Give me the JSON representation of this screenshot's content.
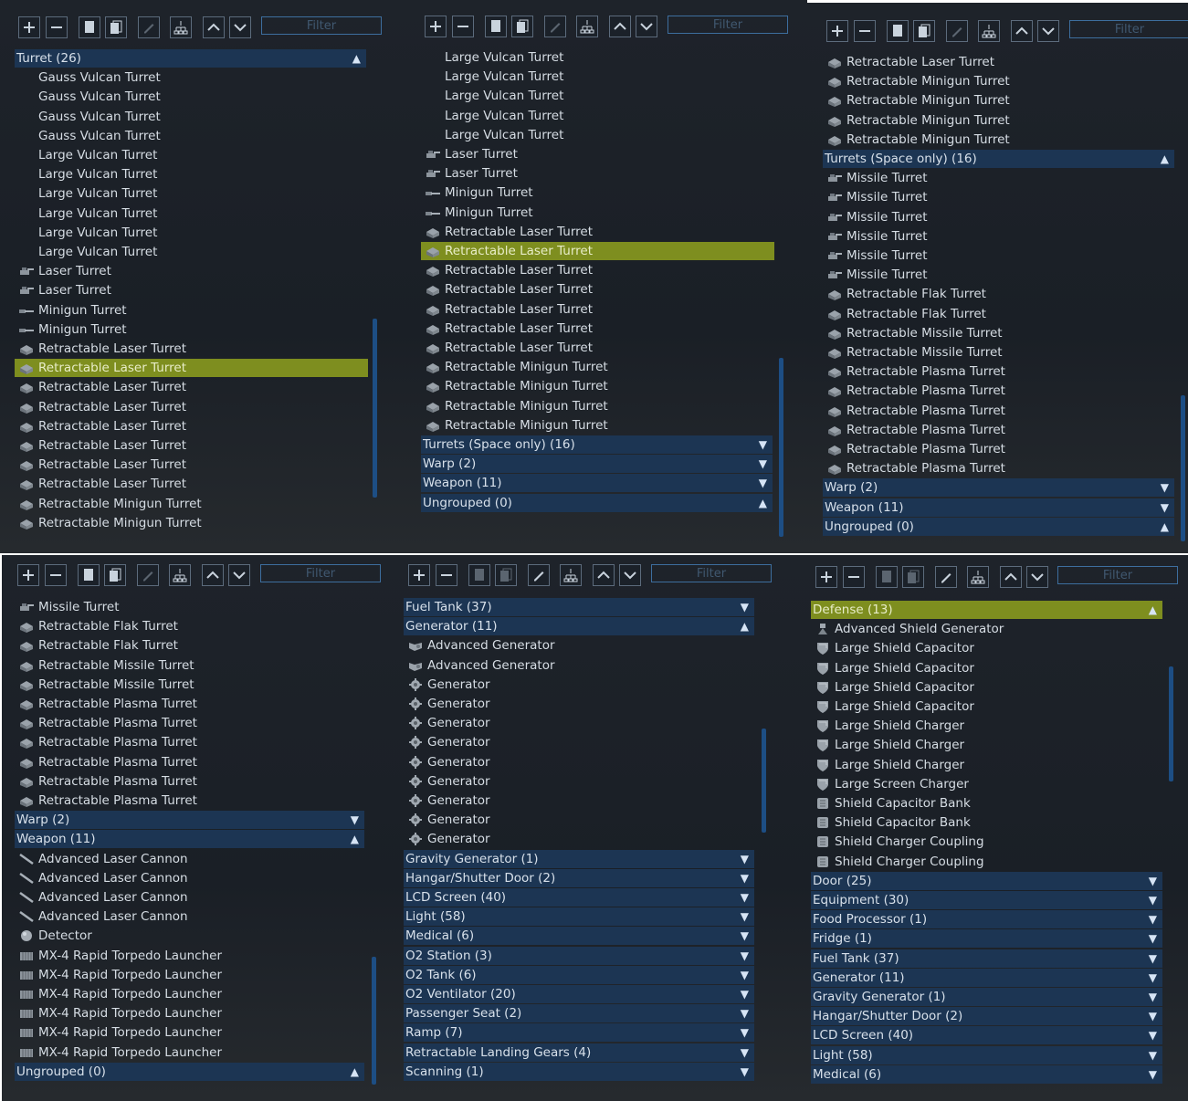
{
  "filter_placeholder": "Filter",
  "panels": [
    {
      "items": [
        {
          "type": "group",
          "label": "Turret (26)",
          "arrow": "▲"
        },
        {
          "type": "item",
          "label": "Gauss Vulcan Turret",
          "icon": "none"
        },
        {
          "type": "item",
          "label": "Gauss Vulcan Turret",
          "icon": "none"
        },
        {
          "type": "item",
          "label": "Gauss Vulcan Turret",
          "icon": "none"
        },
        {
          "type": "item",
          "label": "Gauss Vulcan Turret",
          "icon": "none"
        },
        {
          "type": "item",
          "label": "Large Vulcan Turret",
          "icon": "none"
        },
        {
          "type": "item",
          "label": "Large Vulcan Turret",
          "icon": "none"
        },
        {
          "type": "item",
          "label": "Large Vulcan Turret",
          "icon": "none"
        },
        {
          "type": "item",
          "label": "Large Vulcan Turret",
          "icon": "none"
        },
        {
          "type": "item",
          "label": "Large Vulcan Turret",
          "icon": "none"
        },
        {
          "type": "item",
          "label": "Large Vulcan Turret",
          "icon": "none"
        },
        {
          "type": "item",
          "label": "Laser Turret",
          "icon": "turret"
        },
        {
          "type": "item",
          "label": "Laser Turret",
          "icon": "turret"
        },
        {
          "type": "item",
          "label": "Minigun Turret",
          "icon": "gun"
        },
        {
          "type": "item",
          "label": "Minigun Turret",
          "icon": "gun"
        },
        {
          "type": "item",
          "label": "Retractable Laser Turret",
          "icon": "box"
        },
        {
          "type": "item",
          "label": "Retractable Laser Turret",
          "icon": "box",
          "selected": true
        },
        {
          "type": "item",
          "label": "Retractable Laser Turret",
          "icon": "box"
        },
        {
          "type": "item",
          "label": "Retractable Laser Turret",
          "icon": "box"
        },
        {
          "type": "item",
          "label": "Retractable Laser Turret",
          "icon": "box"
        },
        {
          "type": "item",
          "label": "Retractable Laser Turret",
          "icon": "box"
        },
        {
          "type": "item",
          "label": "Retractable Laser Turret",
          "icon": "box"
        },
        {
          "type": "item",
          "label": "Retractable Laser Turret",
          "icon": "box"
        },
        {
          "type": "item",
          "label": "Retractable Minigun Turret",
          "icon": "box"
        },
        {
          "type": "item",
          "label": "Retractable Minigun Turret",
          "icon": "box"
        }
      ]
    },
    {
      "items": [
        {
          "type": "item",
          "label": "Large Vulcan Turret",
          "icon": "none"
        },
        {
          "type": "item",
          "label": "Large Vulcan Turret",
          "icon": "none"
        },
        {
          "type": "item",
          "label": "Large Vulcan Turret",
          "icon": "none"
        },
        {
          "type": "item",
          "label": "Large Vulcan Turret",
          "icon": "none"
        },
        {
          "type": "item",
          "label": "Large Vulcan Turret",
          "icon": "none"
        },
        {
          "type": "item",
          "label": "Laser Turret",
          "icon": "turret"
        },
        {
          "type": "item",
          "label": "Laser Turret",
          "icon": "turret"
        },
        {
          "type": "item",
          "label": "Minigun Turret",
          "icon": "gun"
        },
        {
          "type": "item",
          "label": "Minigun Turret",
          "icon": "gun"
        },
        {
          "type": "item",
          "label": "Retractable Laser Turret",
          "icon": "box"
        },
        {
          "type": "item",
          "label": "Retractable Laser Turret",
          "icon": "box",
          "selected": true
        },
        {
          "type": "item",
          "label": "Retractable Laser Turret",
          "icon": "box"
        },
        {
          "type": "item",
          "label": "Retractable Laser Turret",
          "icon": "box"
        },
        {
          "type": "item",
          "label": "Retractable Laser Turret",
          "icon": "box"
        },
        {
          "type": "item",
          "label": "Retractable Laser Turret",
          "icon": "box"
        },
        {
          "type": "item",
          "label": "Retractable Laser Turret",
          "icon": "box"
        },
        {
          "type": "item",
          "label": "Retractable Minigun Turret",
          "icon": "box"
        },
        {
          "type": "item",
          "label": "Retractable Minigun Turret",
          "icon": "box"
        },
        {
          "type": "item",
          "label": "Retractable Minigun Turret",
          "icon": "box"
        },
        {
          "type": "item",
          "label": "Retractable Minigun Turret",
          "icon": "box"
        },
        {
          "type": "group",
          "label": "Turrets (Space only) (16)",
          "arrow": "▼"
        },
        {
          "type": "group",
          "label": "Warp (2)",
          "arrow": "▼"
        },
        {
          "type": "group",
          "label": "Weapon (11)",
          "arrow": "▼"
        },
        {
          "type": "group",
          "label": "Ungrouped (0)",
          "arrow": "▲"
        }
      ]
    },
    {
      "items": [
        {
          "type": "item",
          "label": "Retractable Laser Turret",
          "icon": "box"
        },
        {
          "type": "item",
          "label": "Retractable Minigun Turret",
          "icon": "box"
        },
        {
          "type": "item",
          "label": "Retractable Minigun Turret",
          "icon": "box"
        },
        {
          "type": "item",
          "label": "Retractable Minigun Turret",
          "icon": "box"
        },
        {
          "type": "item",
          "label": "Retractable Minigun Turret",
          "icon": "box"
        },
        {
          "type": "group",
          "label": "Turrets (Space only) (16)",
          "arrow": "▲"
        },
        {
          "type": "item",
          "label": "Missile Turret",
          "icon": "turret"
        },
        {
          "type": "item",
          "label": "Missile Turret",
          "icon": "turret"
        },
        {
          "type": "item",
          "label": "Missile Turret",
          "icon": "turret"
        },
        {
          "type": "item",
          "label": "Missile Turret",
          "icon": "turret"
        },
        {
          "type": "item",
          "label": "Missile Turret",
          "icon": "turret"
        },
        {
          "type": "item",
          "label": "Missile Turret",
          "icon": "turret"
        },
        {
          "type": "item",
          "label": "Retractable Flak Turret",
          "icon": "box"
        },
        {
          "type": "item",
          "label": "Retractable Flak Turret",
          "icon": "box"
        },
        {
          "type": "item",
          "label": "Retractable Missile Turret",
          "icon": "box"
        },
        {
          "type": "item",
          "label": "Retractable Missile Turret",
          "icon": "box"
        },
        {
          "type": "item",
          "label": "Retractable Plasma Turret",
          "icon": "box"
        },
        {
          "type": "item",
          "label": "Retractable Plasma Turret",
          "icon": "box"
        },
        {
          "type": "item",
          "label": "Retractable Plasma Turret",
          "icon": "box"
        },
        {
          "type": "item",
          "label": "Retractable Plasma Turret",
          "icon": "box"
        },
        {
          "type": "item",
          "label": "Retractable Plasma Turret",
          "icon": "box"
        },
        {
          "type": "item",
          "label": "Retractable Plasma Turret",
          "icon": "box"
        },
        {
          "type": "group",
          "label": "Warp (2)",
          "arrow": "▼"
        },
        {
          "type": "group",
          "label": "Weapon (11)",
          "arrow": "▼"
        },
        {
          "type": "group",
          "label": "Ungrouped (0)",
          "arrow": "▲"
        }
      ]
    },
    {
      "items": [
        {
          "type": "item",
          "label": "Missile Turret",
          "icon": "turret"
        },
        {
          "type": "item",
          "label": "Retractable Flak Turret",
          "icon": "box"
        },
        {
          "type": "item",
          "label": "Retractable Flak Turret",
          "icon": "box"
        },
        {
          "type": "item",
          "label": "Retractable Missile Turret",
          "icon": "box"
        },
        {
          "type": "item",
          "label": "Retractable Missile Turret",
          "icon": "box"
        },
        {
          "type": "item",
          "label": "Retractable Plasma Turret",
          "icon": "box"
        },
        {
          "type": "item",
          "label": "Retractable Plasma Turret",
          "icon": "box"
        },
        {
          "type": "item",
          "label": "Retractable Plasma Turret",
          "icon": "box"
        },
        {
          "type": "item",
          "label": "Retractable Plasma Turret",
          "icon": "box"
        },
        {
          "type": "item",
          "label": "Retractable Plasma Turret",
          "icon": "box"
        },
        {
          "type": "item",
          "label": "Retractable Plasma Turret",
          "icon": "box"
        },
        {
          "type": "group",
          "label": "Warp (2)",
          "arrow": "▼"
        },
        {
          "type": "group",
          "label": "Weapon (11)",
          "arrow": "▲"
        },
        {
          "type": "item",
          "label": "Advanced Laser Cannon",
          "icon": "cannon"
        },
        {
          "type": "item",
          "label": "Advanced Laser Cannon",
          "icon": "cannon"
        },
        {
          "type": "item",
          "label": "Advanced Laser Cannon",
          "icon": "cannon"
        },
        {
          "type": "item",
          "label": "Advanced Laser Cannon",
          "icon": "cannon"
        },
        {
          "type": "item",
          "label": "Detector",
          "icon": "sphere"
        },
        {
          "type": "item",
          "label": "MX-4 Rapid Torpedo Launcher",
          "icon": "launcher"
        },
        {
          "type": "item",
          "label": "MX-4 Rapid Torpedo Launcher",
          "icon": "launcher"
        },
        {
          "type": "item",
          "label": "MX-4 Rapid Torpedo Launcher",
          "icon": "launcher"
        },
        {
          "type": "item",
          "label": "MX-4 Rapid Torpedo Launcher",
          "icon": "launcher"
        },
        {
          "type": "item",
          "label": "MX-4 Rapid Torpedo Launcher",
          "icon": "launcher"
        },
        {
          "type": "item",
          "label": "MX-4 Rapid Torpedo Launcher",
          "icon": "launcher"
        },
        {
          "type": "group",
          "label": "Ungrouped (0)",
          "arrow": "▲"
        }
      ]
    },
    {
      "items": [
        {
          "type": "group",
          "label": "Fuel Tank (37)",
          "arrow": "▼"
        },
        {
          "type": "group",
          "label": "Generator (11)",
          "arrow": "▲"
        },
        {
          "type": "item",
          "label": "Advanced Generator",
          "icon": "generator"
        },
        {
          "type": "item",
          "label": "Advanced Generator",
          "icon": "generator"
        },
        {
          "type": "item",
          "label": "Generator",
          "icon": "gear"
        },
        {
          "type": "item",
          "label": "Generator",
          "icon": "gear"
        },
        {
          "type": "item",
          "label": "Generator",
          "icon": "gear"
        },
        {
          "type": "item",
          "label": "Generator",
          "icon": "gear"
        },
        {
          "type": "item",
          "label": "Generator",
          "icon": "gear"
        },
        {
          "type": "item",
          "label": "Generator",
          "icon": "gear"
        },
        {
          "type": "item",
          "label": "Generator",
          "icon": "gear"
        },
        {
          "type": "item",
          "label": "Generator",
          "icon": "gear"
        },
        {
          "type": "item",
          "label": "Generator",
          "icon": "gear"
        },
        {
          "type": "group",
          "label": "Gravity Generator (1)",
          "arrow": "▼"
        },
        {
          "type": "group",
          "label": "Hangar/Shutter Door (2)",
          "arrow": "▼"
        },
        {
          "type": "group",
          "label": "LCD Screen (40)",
          "arrow": "▼"
        },
        {
          "type": "group",
          "label": "Light (58)",
          "arrow": "▼"
        },
        {
          "type": "group",
          "label": "Medical (6)",
          "arrow": "▼"
        },
        {
          "type": "group",
          "label": "O2 Station (3)",
          "arrow": "▼"
        },
        {
          "type": "group",
          "label": "O2 Tank (6)",
          "arrow": "▼"
        },
        {
          "type": "group",
          "label": "O2 Ventilator (20)",
          "arrow": "▼"
        },
        {
          "type": "group",
          "label": "Passenger Seat (2)",
          "arrow": "▼"
        },
        {
          "type": "group",
          "label": "Ramp (7)",
          "arrow": "▼"
        },
        {
          "type": "group",
          "label": "Retractable Landing Gears (4)",
          "arrow": "▼"
        },
        {
          "type": "group",
          "label": "Scanning (1)",
          "arrow": "▼"
        }
      ]
    },
    {
      "items": [
        {
          "type": "group",
          "label": "Defense (13)",
          "arrow": "▲",
          "selected": true
        },
        {
          "type": "item",
          "label": "Advanced Shield Generator",
          "icon": "shieldgen"
        },
        {
          "type": "item",
          "label": "Large Shield Capacitor",
          "icon": "shield"
        },
        {
          "type": "item",
          "label": "Large Shield Capacitor",
          "icon": "shield"
        },
        {
          "type": "item",
          "label": "Large Shield Capacitor",
          "icon": "shield"
        },
        {
          "type": "item",
          "label": "Large Shield Capacitor",
          "icon": "shield"
        },
        {
          "type": "item",
          "label": "Large Shield Charger",
          "icon": "shield"
        },
        {
          "type": "item",
          "label": "Large Shield Charger",
          "icon": "shield"
        },
        {
          "type": "item",
          "label": "Large Shield Charger",
          "icon": "shield"
        },
        {
          "type": "item",
          "label": "Large Screen Charger",
          "icon": "shield"
        },
        {
          "type": "item",
          "label": "Shield Capacitor Bank",
          "icon": "bank"
        },
        {
          "type": "item",
          "label": "Shield Capacitor Bank",
          "icon": "bank"
        },
        {
          "type": "item",
          "label": "Shield Charger Coupling",
          "icon": "bank"
        },
        {
          "type": "item",
          "label": "Shield Charger Coupling",
          "icon": "bank"
        },
        {
          "type": "group",
          "label": "Door (25)",
          "arrow": "▼"
        },
        {
          "type": "group",
          "label": "Equipment (30)",
          "arrow": "▼"
        },
        {
          "type": "group",
          "label": "Food Processor (1)",
          "arrow": "▼"
        },
        {
          "type": "group",
          "label": "Fridge (1)",
          "arrow": "▼"
        },
        {
          "type": "group",
          "label": "Fuel Tank (37)",
          "arrow": "▼"
        },
        {
          "type": "group",
          "label": "Generator (11)",
          "arrow": "▼"
        },
        {
          "type": "group",
          "label": "Gravity Generator (1)",
          "arrow": "▼"
        },
        {
          "type": "group",
          "label": "Hangar/Shutter Door (2)",
          "arrow": "▼"
        },
        {
          "type": "group",
          "label": "LCD Screen (40)",
          "arrow": "▼"
        },
        {
          "type": "group",
          "label": "Light (58)",
          "arrow": "▼"
        },
        {
          "type": "group",
          "label": "Medical (6)",
          "arrow": "▼"
        }
      ]
    }
  ]
}
